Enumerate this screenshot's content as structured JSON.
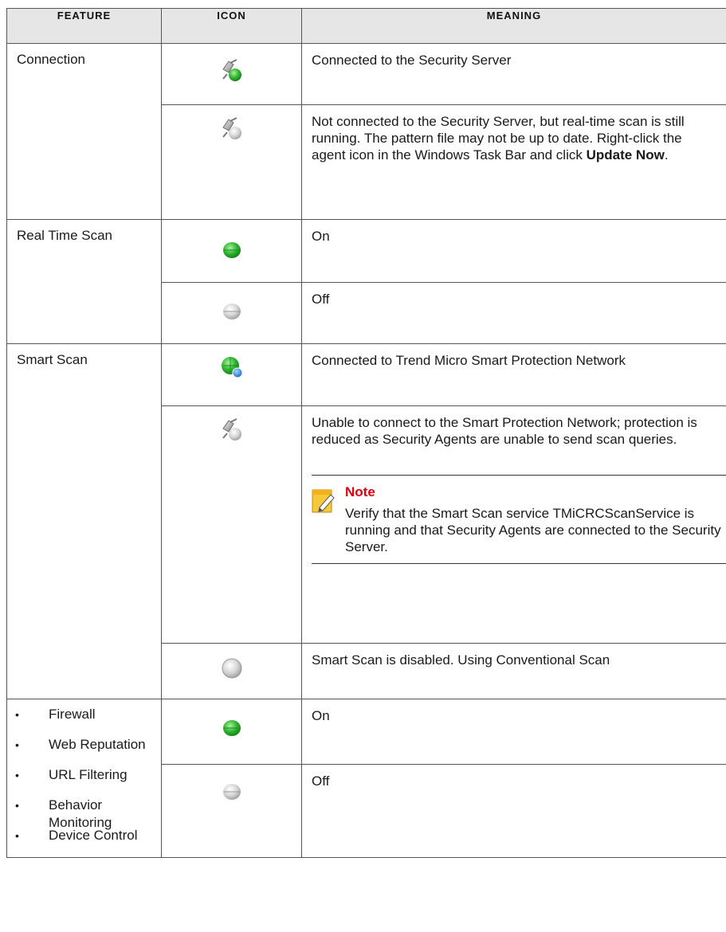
{
  "headers": {
    "feature": "Feature",
    "icon": "Icon",
    "meaning": "Meaning"
  },
  "rows": {
    "connection": {
      "feature": "Connection",
      "m1": "Connected to the Security Server",
      "m2_pre": "Not connected to the Security Server, but real-time scan is still running. The pattern file may not be up to date. Right-click the agent icon in the Windows Task Bar and click ",
      "m2_bold": "Update Now",
      "m2_post": "."
    },
    "realtime": {
      "feature": "Real Time Scan",
      "m1": "On",
      "m2": "Off"
    },
    "smartscan": {
      "feature": "Smart Scan",
      "m1": "Connected to Trend Micro Smart Protection Network",
      "m2": "Unable to connect to the Smart Protection Network; protection is reduced as Security Agents are unable to send scan queries.",
      "note_title": "Note",
      "note_text": "Verify that the Smart Scan service TMiCRCScanService is running and that Security Agents are connected to the Security Server.",
      "m3": "Smart Scan is disabled. Using Conventional Scan"
    },
    "others": {
      "items": [
        "Firewall",
        "Web Reputation",
        "URL Filtering",
        "Behavior Monitoring",
        "Device Control"
      ],
      "m1": "On",
      "m2": "Off"
    }
  },
  "icons": {
    "connected": "network-connected-icon",
    "disconnected": "network-disconnected-icon",
    "on": "green-status-icon",
    "off": "gray-status-icon",
    "smart_connected": "globe-connected-icon",
    "note": "note-pencil-icon"
  },
  "colors": {
    "header_bg": "#e6e6e6",
    "note_title": "#e3000f",
    "on_green": "#2fb52f",
    "off_gray": "#cfcfcf"
  }
}
